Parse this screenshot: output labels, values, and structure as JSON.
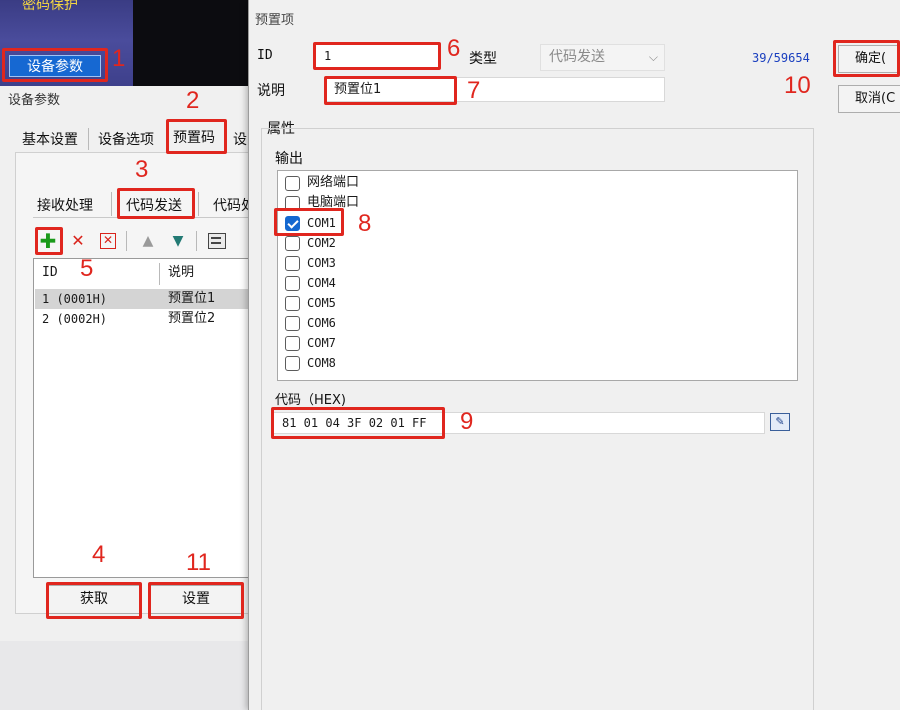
{
  "background_app": {
    "password_protect_label": "密码保护",
    "device_params_button": "设备参数"
  },
  "left_dialog": {
    "title": "设备参数",
    "main_tabs": [
      "基本设置",
      "设备选项",
      "预置码",
      "设"
    ],
    "sub_tabs": [
      "接收处理",
      "代码发送",
      "代码处"
    ],
    "list_headers": [
      "ID",
      "说明"
    ],
    "rows": [
      {
        "id": "1 (0001H)",
        "desc": "预置位1"
      },
      {
        "id": "2 (0002H)",
        "desc": "预置位2"
      }
    ],
    "get_button": "获取",
    "set_button": "设置"
  },
  "right_dialog": {
    "title": "预置项",
    "id_label": "ID",
    "id_value": "1",
    "type_label": "类型",
    "type_value": "代码发送",
    "counter": "39/59654",
    "desc_label": "说明",
    "desc_value": "预置位1",
    "ok_button": "确定(",
    "cancel_button": "取消(C",
    "attributes_label": "属性",
    "output_label": "输出",
    "outputs": [
      {
        "label": "网络端口",
        "checked": false
      },
      {
        "label": "电脑端口",
        "checked": false
      },
      {
        "label": "COM1",
        "checked": true
      },
      {
        "label": "COM2",
        "checked": false
      },
      {
        "label": "COM3",
        "checked": false
      },
      {
        "label": "COM4",
        "checked": false
      },
      {
        "label": "COM5",
        "checked": false
      },
      {
        "label": "COM6",
        "checked": false
      },
      {
        "label": "COM7",
        "checked": false
      },
      {
        "label": "COM8",
        "checked": false
      }
    ],
    "code_label": "代码（HEX)",
    "code_value": "81 01 04 3F 02 01 FF"
  },
  "annotations": [
    "1",
    "2",
    "3",
    "4",
    "5",
    "6",
    "7",
    "8",
    "9",
    "10",
    "11"
  ],
  "colors": {
    "annotation_red": "#e0261e",
    "accent_blue": "#1468d0",
    "counter_blue": "#1a3fbf"
  }
}
